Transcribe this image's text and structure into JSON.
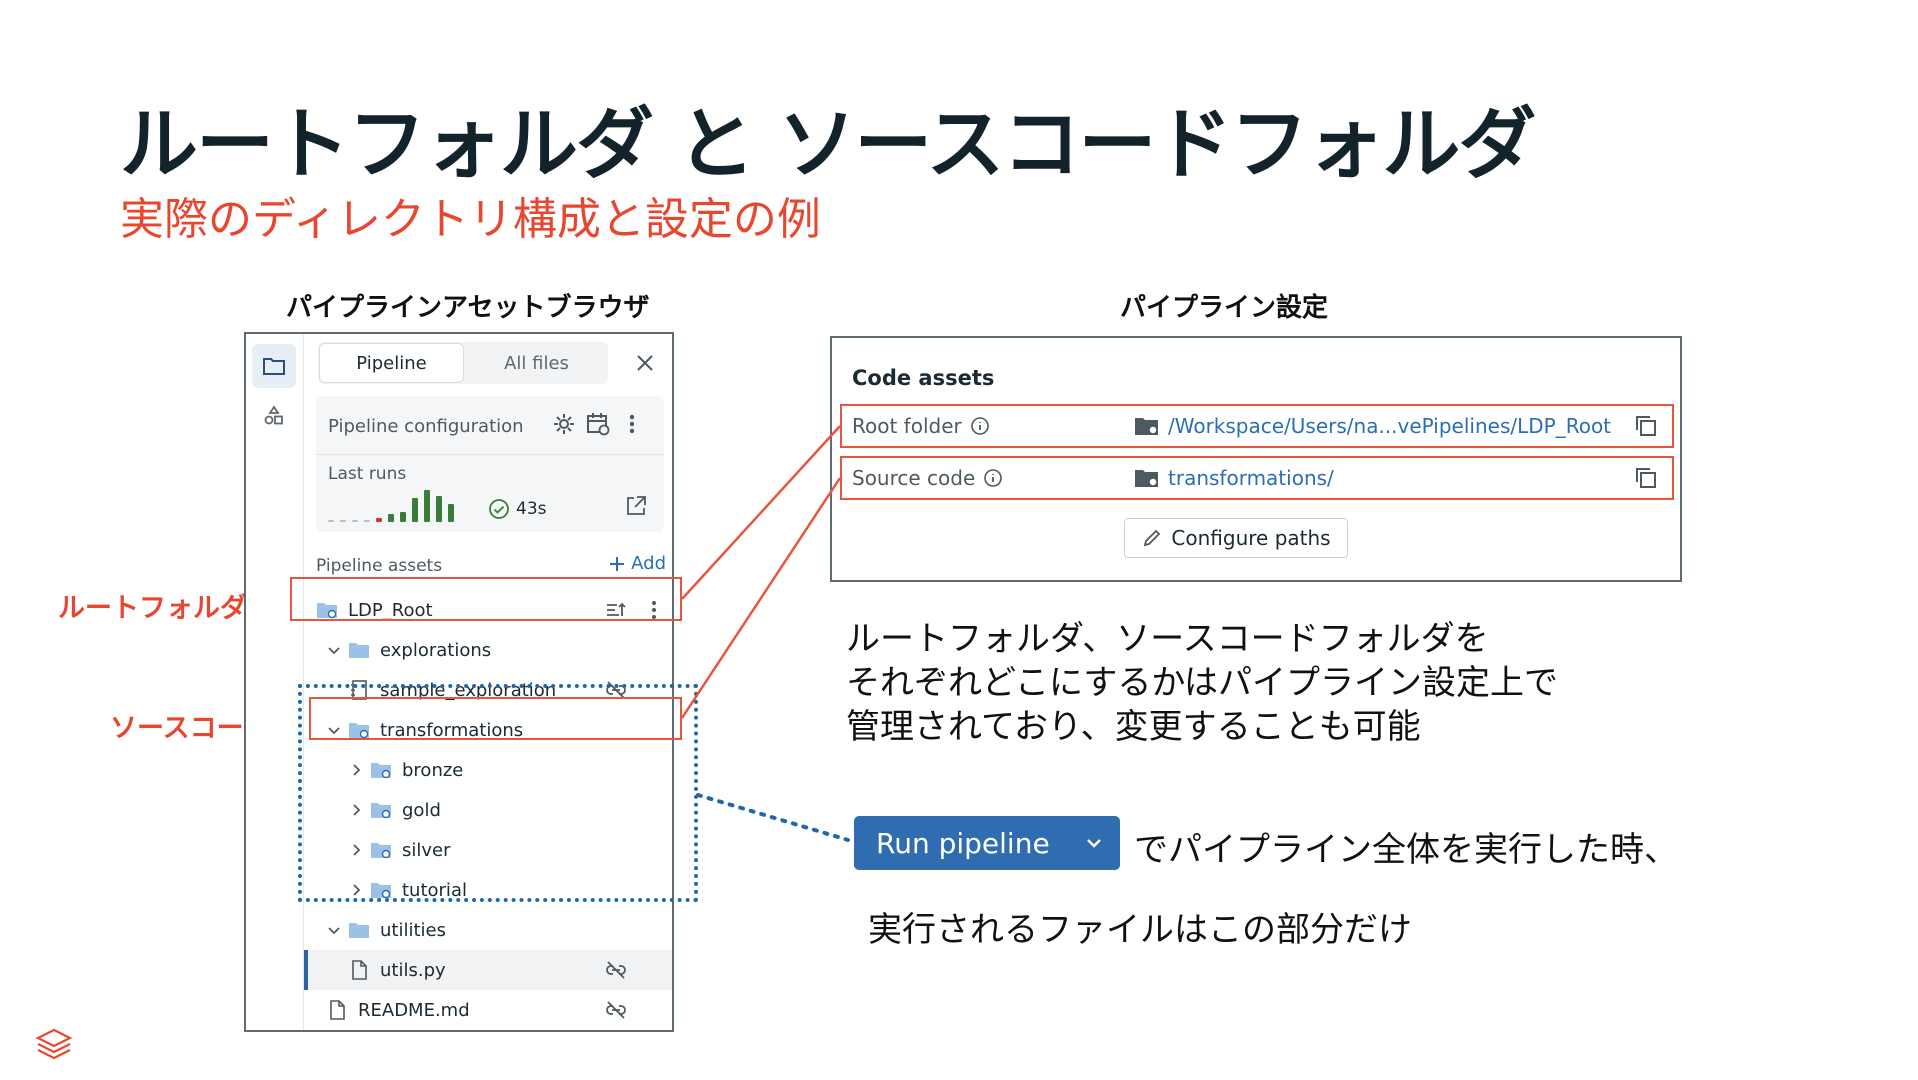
{
  "title": "ルートフォルダ と ソースコードフォルダ",
  "subtitle": "実際のディレクトリ構成と設定の例",
  "left_section_label": "パイプラインアセットブラウザ",
  "right_section_label": "パイプライン設定",
  "labels": {
    "root_folder": "ルートフォルダ",
    "source_code": "ソースコード"
  },
  "browser": {
    "tabs": [
      "Pipeline",
      "All files"
    ],
    "active_tab": "Pipeline",
    "config_title": "Pipeline configuration",
    "last_runs_label": "Last runs",
    "last_run_duration": "43s",
    "assets_label": "Pipeline assets",
    "add_label": "Add",
    "tree": [
      {
        "name": "LDP_Root",
        "kind": "root-folder"
      },
      {
        "name": "explorations",
        "kind": "folder"
      },
      {
        "name": "sample_exploration",
        "kind": "notebook"
      },
      {
        "name": "transformations",
        "kind": "source-folder"
      },
      {
        "name": "bronze",
        "kind": "source-folder"
      },
      {
        "name": "gold",
        "kind": "source-folder"
      },
      {
        "name": "silver",
        "kind": "source-folder"
      },
      {
        "name": "tutorial",
        "kind": "source-folder"
      },
      {
        "name": "utilities",
        "kind": "folder"
      },
      {
        "name": "utils.py",
        "kind": "file"
      },
      {
        "name": "README.md",
        "kind": "file"
      }
    ],
    "colors": {
      "run_success": "#3a7d3a",
      "run_fail": "#c23b2e",
      "run_empty": "#b8bec2"
    }
  },
  "settings": {
    "code_assets_title": "Code assets",
    "root_folder_label": "Root folder",
    "root_folder_value": "/Workspace/Users/na...vePipelines/LDP_Root",
    "source_code_label": "Source code",
    "source_code_value": "transformations/",
    "configure_paths_label": "Configure paths"
  },
  "description_lines": [
    "ルートフォルダ、ソースコードフォルダを",
    "それぞれどこにするかはパイプライン設定上で",
    "管理されており、変更することも可能"
  ],
  "run_button_label": "Run pipeline",
  "run_text_1": "でパイプライン全体を実行した時、",
  "run_text_2": "実行されるファイルはこの部分だけ",
  "colors": {
    "accent_red": "#e8472f",
    "highlight_blue": "#2267a6",
    "link_blue": "#2a6fb5",
    "run_button": "#2f6cb0"
  }
}
